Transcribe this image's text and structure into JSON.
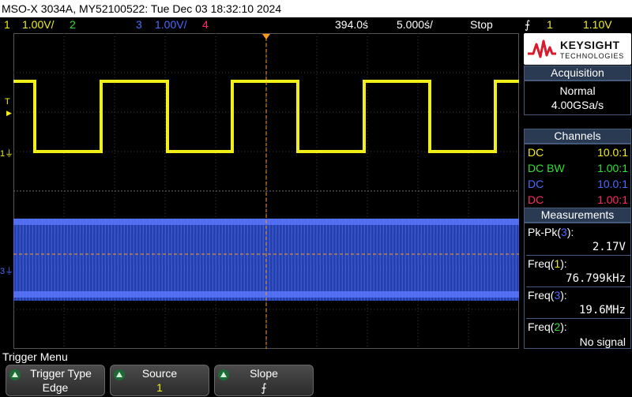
{
  "title": "MSO-X 3034A, MY52100522: Tue Dec 03 18:32:10 2024",
  "colors": {
    "ch1": "#f2ee1a",
    "ch2": "#30e030",
    "ch3": "#4a6bff",
    "ch4": "#ff2a6a",
    "trigger": "#ff9b1c",
    "panel_title": "#2a3a53",
    "panel_border": "#445a7a"
  },
  "status": {
    "ch1_num": "1",
    "ch1_scale": "1.00V/",
    "ch2_num": "2",
    "ch3_num": "3",
    "ch3_scale": "1.00V/",
    "ch4_num": "4",
    "delay": "394.0ś",
    "timebase": "5.000ś/",
    "run_state": "Stop",
    "trig_slope_icon": "rising-edge-icon",
    "trig_slope_glyph": "⨍",
    "trig_src": "1",
    "trig_level": "1.10V"
  },
  "markers": {
    "trig_level": "T",
    "ch1": "1",
    "ch3": "3"
  },
  "logo": {
    "brand": "KEYSIGHT",
    "sub": "TECHNOLOGIES"
  },
  "acquisition": {
    "title": "Acquisition",
    "mode": "Normal",
    "rate": "4.00GSa/s"
  },
  "channels": {
    "title": "Channels",
    "rows": [
      {
        "coupling": "DC",
        "probe": "10.0:1"
      },
      {
        "coupling": "DC BW",
        "probe": "1.00:1"
      },
      {
        "coupling": "DC",
        "probe": "10.0:1"
      },
      {
        "coupling": "DC",
        "probe": "1.00:1"
      }
    ]
  },
  "measurements": {
    "title": "Measurements",
    "items": [
      {
        "label": "Pk-Pk",
        "src": "3",
        "value": "2.17V"
      },
      {
        "label": "Freq",
        "src": "1",
        "value": "76.799kHz"
      },
      {
        "label": "Freq",
        "src": "3",
        "value": "19.6MHz"
      },
      {
        "label": "Freq",
        "src": "2",
        "value": "No signal"
      }
    ]
  },
  "menu": {
    "title": "Trigger Menu",
    "keys": [
      {
        "label": "Trigger Type",
        "value": "Edge"
      },
      {
        "label": "Source",
        "value": "1"
      },
      {
        "label": "Slope",
        "value": "⨍"
      }
    ]
  }
}
